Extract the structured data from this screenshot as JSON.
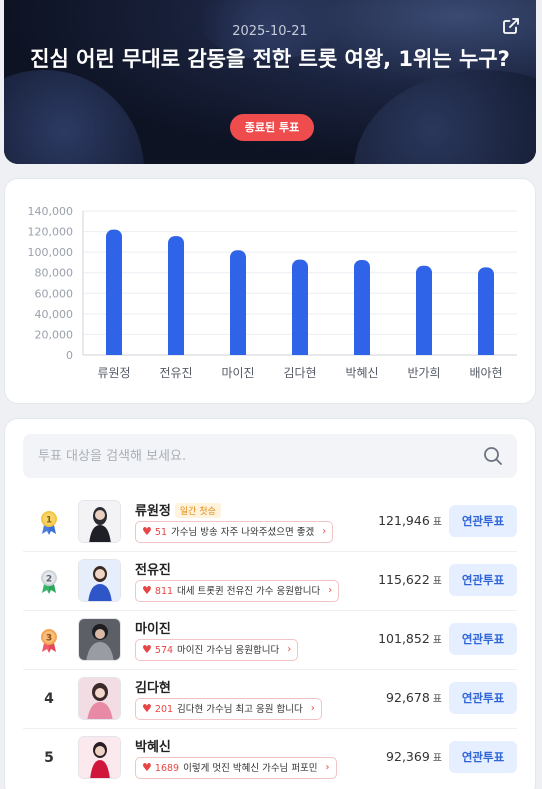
{
  "hero": {
    "date": "2025-10-21",
    "title": "진심 어린 무대로 감동을 전한 트롯 여왕, 1위는 누구?",
    "status_badge": "종료된 투표"
  },
  "search": {
    "placeholder": "투표 대상을 검색해 보세요."
  },
  "colors": {
    "bar": "#2f63e8",
    "badge_red": "#ef4d4d",
    "button_bg": "#e5efff",
    "button_text": "#2f65d8"
  },
  "chart_data": {
    "type": "bar",
    "categories": [
      "류원정",
      "전유진",
      "마이진",
      "김다현",
      "박혜신",
      "반가희",
      "배아현"
    ],
    "values": [
      121946,
      115622,
      101852,
      92678,
      92369,
      86800,
      85200
    ],
    "yticks": [
      "0",
      "20,000",
      "40,000",
      "60,000",
      "80,000",
      "100,000",
      "120,000",
      "140,000"
    ],
    "ylim": [
      0,
      140000
    ],
    "grid": true
  },
  "list": {
    "button_label": "연관투표",
    "vote_unit": "표",
    "items": [
      {
        "rank": "1",
        "medal": "gold",
        "name": "류원정",
        "tag": "일간 첫승",
        "comment_count": "51",
        "comment": "가수님 방송 자주 나와주셨으면 좋겠",
        "votes": "121,946"
      },
      {
        "rank": "2",
        "medal": "silver",
        "name": "전유진",
        "tag": "",
        "comment_count": "811",
        "comment": "대세 트롯퀸 전유진 가수 응원합니다",
        "votes": "115,622"
      },
      {
        "rank": "3",
        "medal": "bronze",
        "name": "마이진",
        "tag": "",
        "comment_count": "574",
        "comment": "마이진 가수님 응원합니다",
        "votes": "101,852"
      },
      {
        "rank": "4",
        "medal": "",
        "name": "김다현",
        "tag": "",
        "comment_count": "201",
        "comment": "김다현 가수님 최고 응원 합니다",
        "votes": "92,678"
      },
      {
        "rank": "5",
        "medal": "",
        "name": "박혜신",
        "tag": "",
        "comment_count": "1689",
        "comment": "이렇게 멋진 박혜신 가수님 퍼포민",
        "votes": "92,369"
      }
    ]
  }
}
